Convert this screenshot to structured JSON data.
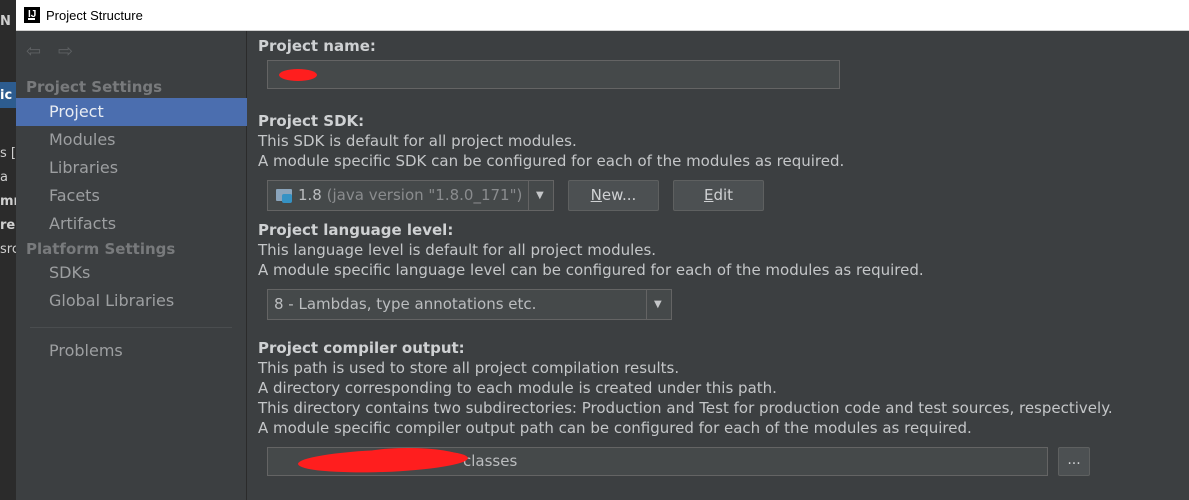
{
  "background": {
    "fragments": [
      "N",
      "ic",
      "s [",
      "a",
      "mr",
      "re",
      "src"
    ]
  },
  "window": {
    "title": "Project Structure",
    "app_icon_text": "IJ"
  },
  "sidebar": {
    "back_glyph": "⇦",
    "forward_glyph": "⇨",
    "project_settings_label": "Project Settings",
    "platform_settings_label": "Platform Settings",
    "items": [
      {
        "label": "Project",
        "selected": true
      },
      {
        "label": "Modules"
      },
      {
        "label": "Libraries"
      },
      {
        "label": "Facets"
      },
      {
        "label": "Artifacts"
      },
      {
        "label": "SDKs"
      },
      {
        "label": "Global Libraries"
      },
      {
        "label": "Problems"
      }
    ]
  },
  "content": {
    "project_name_label": "Project name:",
    "project_name_value": "",
    "sdk_label": "Project SDK:",
    "sdk_desc_1": "This SDK is default for all project modules.",
    "sdk_desc_2": "A module specific SDK can be configured for each of the modules as required.",
    "sdk_selected_name": "1.8",
    "sdk_selected_version": "(java version \"1.8.0_171\")",
    "new_button": "New...",
    "edit_button": "Edit",
    "language_label": "Project language level:",
    "language_desc_1": "This language level is default for all project modules.",
    "language_desc_2": "A module specific language level can be configured for each of the modules as required.",
    "language_selected": "8 - Lambdas, type annotations etc.",
    "output_label": "Project compiler output:",
    "output_desc_1": "This path is used to store all project compilation results.",
    "output_desc_2": "A directory corresponding to each module is created under this path.",
    "output_desc_3": "This directory contains two subdirectories: Production and Test for production code and test sources, respectively.",
    "output_desc_4": "A module specific compiler output path can be configured for each of the modules as required.",
    "output_value_visible": "classes",
    "browse_button": "...",
    "dropdown_arrow": "▼"
  },
  "colors": {
    "selection": "#4b6eaf",
    "panel": "#3c3f41",
    "redaction": "#ff1e1e"
  }
}
